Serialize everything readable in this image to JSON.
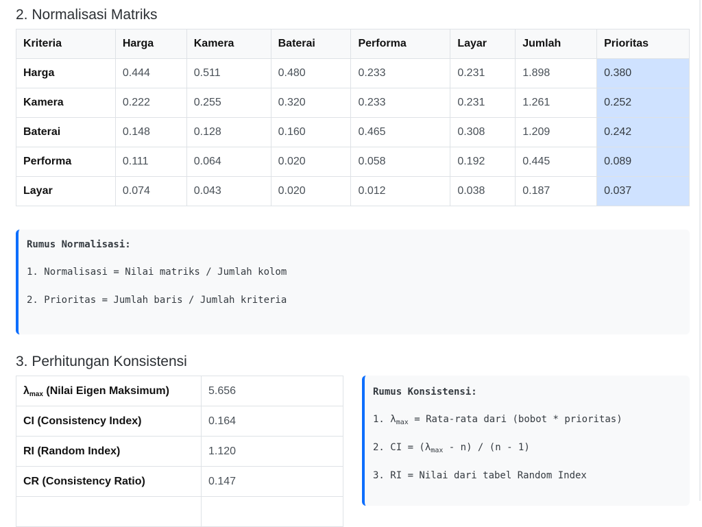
{
  "normalisasi": {
    "heading": "2. Normalisasi Matriks",
    "columns": [
      "Kriteria",
      "Harga",
      "Kamera",
      "Baterai",
      "Performa",
      "Layar",
      "Jumlah",
      "Prioritas"
    ],
    "rows": [
      {
        "label": "Harga",
        "values": [
          "0.444",
          "0.511",
          "0.480",
          "0.233",
          "0.231",
          "1.898"
        ],
        "prioritas": "0.380"
      },
      {
        "label": "Kamera",
        "values": [
          "0.222",
          "0.255",
          "0.320",
          "0.233",
          "0.231",
          "1.261"
        ],
        "prioritas": "0.252"
      },
      {
        "label": "Baterai",
        "values": [
          "0.148",
          "0.128",
          "0.160",
          "0.465",
          "0.308",
          "1.209"
        ],
        "prioritas": "0.242"
      },
      {
        "label": "Performa",
        "values": [
          "0.111",
          "0.064",
          "0.020",
          "0.058",
          "0.192",
          "0.445"
        ],
        "prioritas": "0.089"
      },
      {
        "label": "Layar",
        "values": [
          "0.074",
          "0.043",
          "0.020",
          "0.012",
          "0.038",
          "0.187"
        ],
        "prioritas": "0.037"
      }
    ],
    "highlight_color": "#cfe2ff",
    "formula": {
      "title": "Rumus Normalisasi:",
      "lines": [
        "1. Normalisasi = Nilai matriks / Jumlah kolom",
        "2. Prioritas = Jumlah baris / Jumlah kriteria"
      ]
    }
  },
  "konsistensi": {
    "heading": "3. Perhitungan Konsistensi",
    "rows": [
      {
        "label_pre": "λ",
        "label_sub": "max",
        "label_post": " (Nilai Eigen Maksimum)",
        "value": "5.656"
      },
      {
        "label_pre": "CI (Consistency Index)",
        "label_sub": "",
        "label_post": "",
        "value": "0.164"
      },
      {
        "label_pre": "RI (Random Index)",
        "label_sub": "",
        "label_post": "",
        "value": "1.120"
      },
      {
        "label_pre": "CR (Consistency Ratio)",
        "label_sub": "",
        "label_post": "",
        "value": "0.147"
      }
    ],
    "formula": {
      "title": "Rumus Konsistensi:",
      "lines": [
        {
          "pre": "1. λ",
          "sub": "max",
          "post": " = Rata-rata dari (bobot * prioritas)"
        },
        {
          "pre": "2. CI = (λ",
          "sub": "max",
          "post": " - n) / (n - 1)"
        },
        {
          "pre": "3. RI = Nilai dari tabel Random Index",
          "sub": "",
          "post": ""
        }
      ]
    }
  },
  "accent_color": "#0d6efd"
}
